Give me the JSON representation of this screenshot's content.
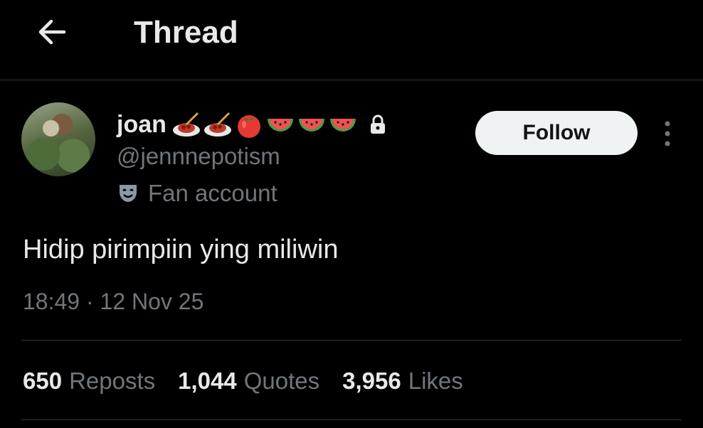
{
  "header": {
    "title": "Thread",
    "back_icon": "arrow-left-icon"
  },
  "tweet": {
    "author": {
      "name": "joan",
      "name_emoji": [
        "spaghetti",
        "spaghetti",
        "tomato",
        "watermelon",
        "watermelon",
        "watermelon"
      ],
      "protected_icon": "lock-icon",
      "handle": "@jennnepotism",
      "label_icon": "theater-masks-icon",
      "label": "Fan account"
    },
    "follow_label": "Follow",
    "more_icon": "more-vertical-icon",
    "text": "Hidip pirimpiin ying miliwin",
    "timestamp": "18:49 · 12 Nov 25",
    "stats": [
      {
        "count": "650",
        "label": "Reposts"
      },
      {
        "count": "1,044",
        "label": "Quotes"
      },
      {
        "count": "3,956",
        "label": "Likes"
      }
    ]
  },
  "colors": {
    "background": "#000000",
    "text": "#e7e9ea",
    "secondary": "#71767b",
    "divider": "#2f3336",
    "button_bg": "#eff3f4"
  }
}
